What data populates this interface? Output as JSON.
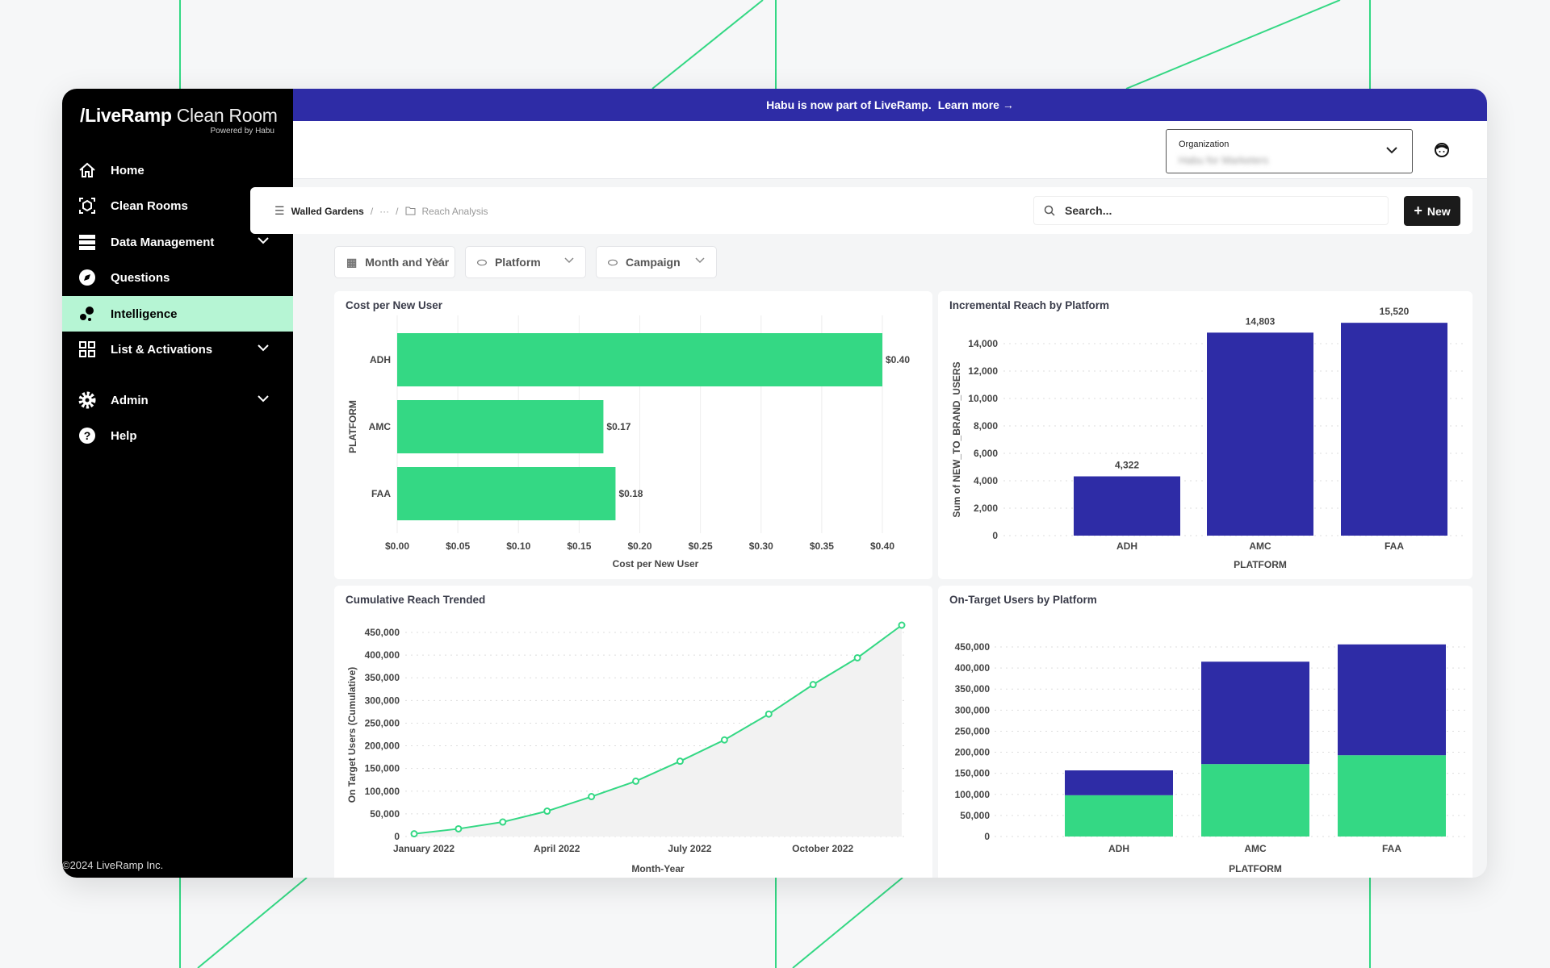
{
  "brand": {
    "name": "/LiveRamp",
    "product": "Clean Room",
    "powered": "Powered by Habu"
  },
  "sidebar": {
    "items": [
      {
        "label": "Home",
        "icon": "home-icon"
      },
      {
        "label": "Clean Rooms",
        "icon": "cube-scan-icon",
        "expandable": true
      },
      {
        "label": "Data Management",
        "icon": "database-icon",
        "expandable": true
      },
      {
        "label": "Questions",
        "icon": "compass-icon"
      },
      {
        "label": "Intelligence",
        "icon": "bubbles-icon",
        "active": true
      },
      {
        "label": "List & Activations",
        "icon": "grid-icon",
        "expandable": true
      },
      {
        "label": "Admin",
        "icon": "gear-icon",
        "expandable": true
      },
      {
        "label": "Help",
        "icon": "help-icon"
      }
    ],
    "copyright": "©2024 LiveRamp Inc."
  },
  "banner": {
    "text": "Habu is now part of LiveRamp.",
    "link": "Learn more →"
  },
  "header": {
    "org_label": "Organization",
    "org_value": "Habu for Marketers"
  },
  "breadcrumb": {
    "root": "Walled Gardens",
    "ellipsis": "···",
    "current": "Reach Analysis"
  },
  "search": {
    "placeholder": "Search..."
  },
  "new_button": "New",
  "filters": [
    "Month and Year",
    "Platform",
    "Campaign"
  ],
  "colors": {
    "green": "#34d884",
    "navy": "#2e2ca6",
    "banner": "#2e2ca6",
    "active": "#b6f5d4"
  },
  "chart_data": [
    {
      "type": "bar",
      "orientation": "horizontal",
      "title": "Cost per New User",
      "categories": [
        "ADH",
        "AMC",
        "FAA"
      ],
      "values": [
        0.4,
        0.17,
        0.18
      ],
      "data_labels": [
        "$0.40",
        "$0.17",
        "$0.18"
      ],
      "xlabel": "Cost per New User",
      "ylabel": "PLATFORM",
      "xlim": [
        0,
        0.4
      ],
      "xticks": [
        "$0.00",
        "$0.05",
        "$0.10",
        "$0.15",
        "$0.20",
        "$0.25",
        "$0.30",
        "$0.35",
        "$0.40"
      ],
      "grid": true
    },
    {
      "type": "bar",
      "title": "Incremental Reach by Platform",
      "categories": [
        "ADH",
        "AMC",
        "FAA"
      ],
      "values": [
        4322,
        14803,
        15520
      ],
      "data_labels": [
        "4,322",
        "14,803",
        "15,520"
      ],
      "xlabel": "PLATFORM",
      "ylabel": "Sum of NEW_TO_BRAND_USERS",
      "ylim": [
        0,
        14000
      ],
      "yticks": [
        "0",
        "2,000",
        "4,000",
        "6,000",
        "8,000",
        "10,000",
        "12,000",
        "14,000"
      ],
      "grid": true
    },
    {
      "type": "area",
      "title": "Cumulative Reach Trended",
      "x": [
        "2022-01",
        "2022-02",
        "2022-03",
        "2022-04",
        "2022-05",
        "2022-06",
        "2022-07",
        "2022-08",
        "2022-09",
        "2022-10",
        "2022-11",
        "2022-12"
      ],
      "values": [
        6000,
        17000,
        32000,
        56000,
        88000,
        122000,
        166000,
        213000,
        270000,
        335000,
        394000,
        466000
      ],
      "xticks": [
        "January 2022",
        "April 2022",
        "July 2022",
        "October 2022"
      ],
      "xlabel": "Month-Year",
      "ylabel": "On Target Users (Cumulative)",
      "ylim": [
        0,
        450000
      ],
      "yticks": [
        "0",
        "50,000",
        "100,000",
        "150,000",
        "200,000",
        "250,000",
        "300,000",
        "350,000",
        "400,000",
        "450,000"
      ],
      "grid": true
    },
    {
      "type": "bar",
      "stacked": true,
      "title": "On-Target Users by Platform",
      "categories": [
        "ADH",
        "AMC",
        "FAA"
      ],
      "series": [
        {
          "values": [
            98000,
            172000,
            193000
          ]
        },
        {
          "values": [
            59000,
            243000,
            263000
          ]
        }
      ],
      "xlabel": "PLATFORM",
      "ylim": [
        0,
        450000
      ],
      "yticks": [
        "0",
        "50,000",
        "100,000",
        "150,000",
        "200,000",
        "250,000",
        "300,000",
        "350,000",
        "400,000",
        "450,000"
      ],
      "grid": true
    }
  ]
}
